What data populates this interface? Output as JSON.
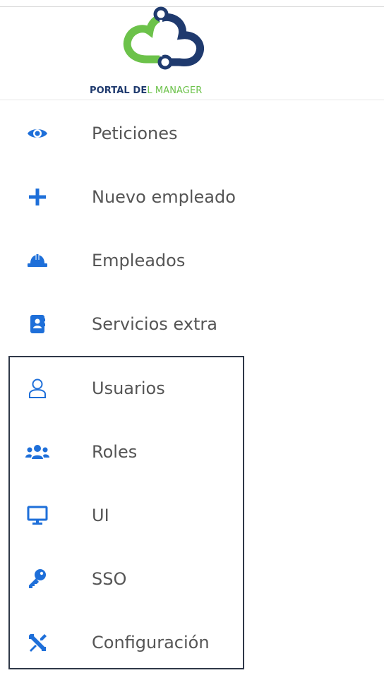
{
  "logo": {
    "part1": "PORTAL DE",
    "part2": "L MANAGER",
    "colors": {
      "dark": "#1f3a6e",
      "green": "#6cc24a"
    }
  },
  "menu": {
    "items": [
      {
        "label": "Peticiones",
        "icon": "eye-icon"
      },
      {
        "label": "Nuevo empleado",
        "icon": "plus-icon"
      },
      {
        "label": "Empleados",
        "icon": "hard-hat-icon"
      },
      {
        "label": "Servicios extra",
        "icon": "contact-card-icon"
      }
    ],
    "admin_items": [
      {
        "label": "Usuarios",
        "icon": "user-icon"
      },
      {
        "label": "Roles",
        "icon": "users-group-icon"
      },
      {
        "label": "UI",
        "icon": "monitor-icon"
      },
      {
        "label": "SSO",
        "icon": "key-icon"
      },
      {
        "label": "Configuración",
        "icon": "tools-icon"
      }
    ]
  },
  "colors": {
    "icon": "#1e6fd9",
    "label": "#555555",
    "box_border": "#2f3848"
  }
}
